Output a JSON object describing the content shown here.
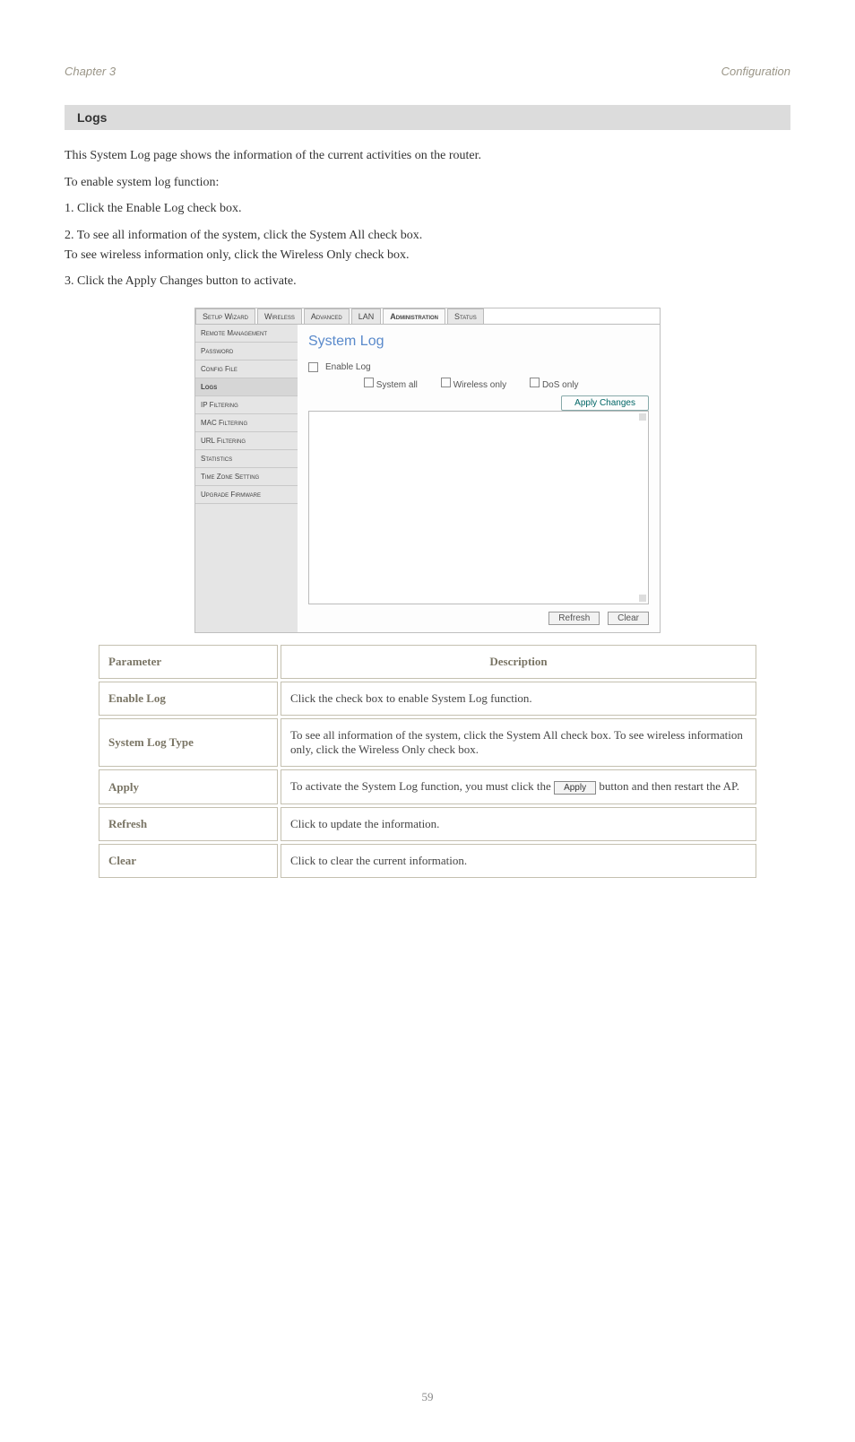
{
  "header": {
    "chapter_no": "Chapter 3",
    "chapter_title": "Configuration"
  },
  "section": {
    "title": "Logs"
  },
  "prose": {
    "p1": "This System Log page shows the information of the current activities on the router.",
    "p2": "To enable system log function:",
    "s1_label": "1.",
    "s1_text": "Click the Enable Log check box.",
    "s2_label": "2.",
    "s2_text": "To see all information of the system, click the System All check box.",
    "s2_text_b": "To see wireless information only, click the Wireless Only check box.",
    "s3_label": "3.",
    "s3_text": "Click the Apply Changes button to activate."
  },
  "tabs": {
    "t0": "Setup Wizard",
    "t1": "Wireless",
    "t2": "Advanced",
    "t3": "LAN",
    "t4": "Administration",
    "t5": "Status"
  },
  "sidebar": {
    "i0": "Remote Management",
    "i1": "Password",
    "i2": "Config File",
    "i3": "Logs",
    "i4": "IP Filtering",
    "i5": "MAC Filtering",
    "i6": "URL Filtering",
    "i7": "Statistics",
    "i8": "Time Zone Setting",
    "i9": "Upgrade Firmware"
  },
  "content": {
    "title": "System Log",
    "enable_cb_label": "Enable Log",
    "opt_all": "System all",
    "opt_wireless": "Wireless only",
    "opt_dos": "DoS only",
    "apply": "Apply Changes",
    "refresh": "Refresh",
    "clear": "Clear"
  },
  "table": {
    "h1": "Parameter",
    "h2": "Description",
    "r1c1": "Enable Log",
    "r1c2": "Click the check box to enable System Log function.",
    "r2c1": "System Log Type",
    "r2c2": "To see all information of the system, click the System All check box. To see wireless information only, click the Wireless Only check box.",
    "r3c1": "Apply",
    "r3c2_a": "To activate the System Log function, you must click the ",
    "r3c2_btn": "Apply",
    "r3c2_b": " button and then restart the AP.",
    "r4c1": "Refresh",
    "r4c2": "Click to update the information.",
    "r5c1": "Clear",
    "r5c2": "Click to clear the current information."
  },
  "page_no": "59"
}
